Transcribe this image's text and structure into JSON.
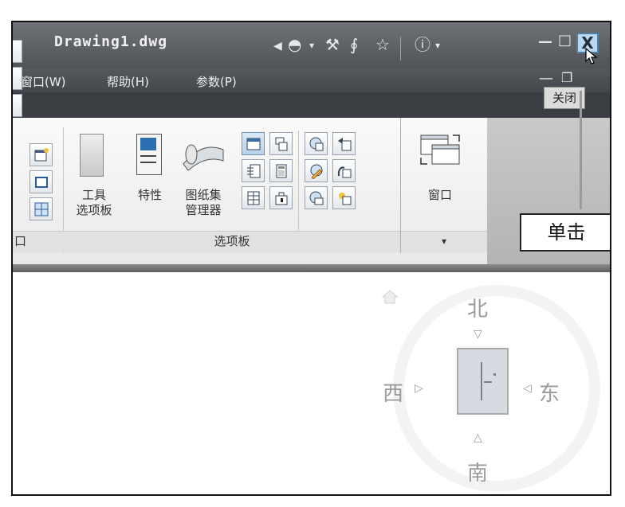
{
  "app": {
    "title": "Drawing1.dwg",
    "close_tooltip": "关闭",
    "callout": "单击"
  },
  "menu": {
    "items": [
      "窗口(W)",
      "帮助(H)",
      "参数(P)"
    ]
  },
  "window_buttons": {
    "minimize": "—",
    "maximize": "□",
    "close": "X"
  },
  "ribbon": {
    "panels": [
      {
        "name": "口"
      },
      {
        "name": "选项板"
      },
      {
        "name": "▾"
      }
    ],
    "big_buttons": [
      {
        "label_line1": "工具",
        "label_line2": "选项板"
      },
      {
        "label_line1": "特性",
        "label_line2": ""
      },
      {
        "label_line1": "图纸集",
        "label_line2": "管理器"
      },
      {
        "label_line1": "窗口",
        "label_line2": ""
      }
    ]
  },
  "viewcube": {
    "north": "北",
    "south": "南",
    "east": "东",
    "west": "西"
  },
  "colors": {
    "titlebar": "#5c6065",
    "ribbon_bg": "#f2f2f2",
    "close_highlight": "#b9d7ee"
  }
}
